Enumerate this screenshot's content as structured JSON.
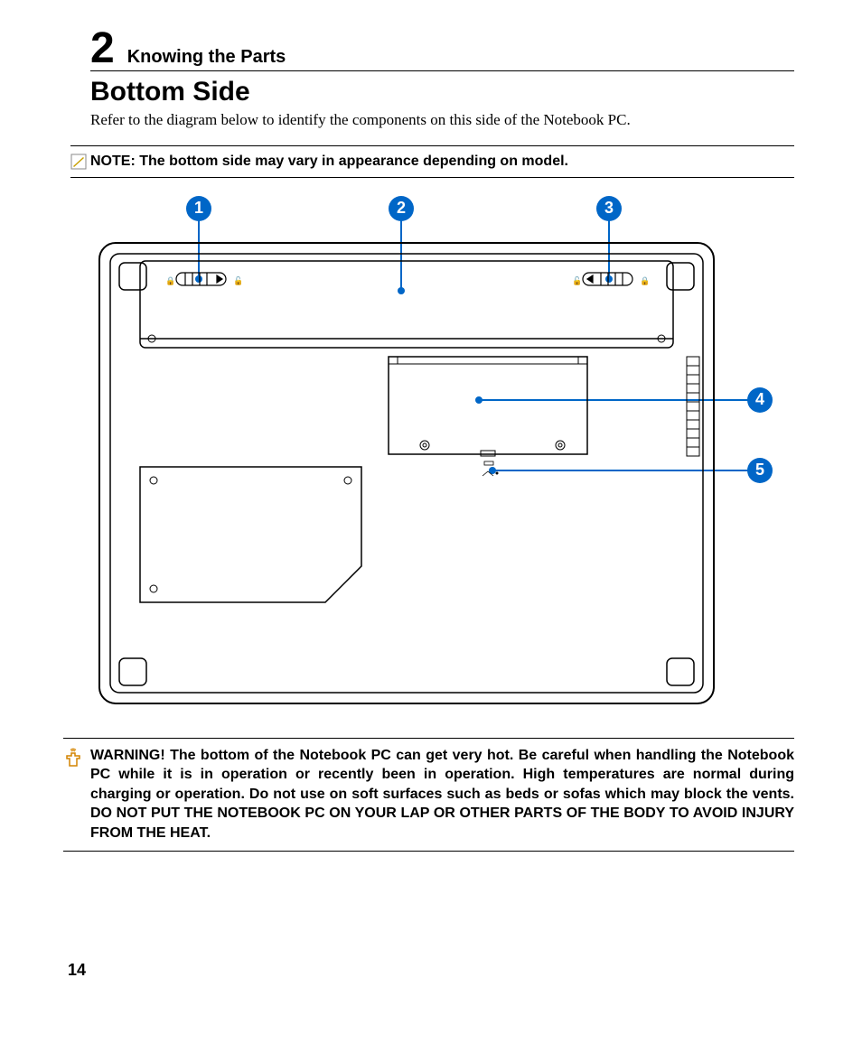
{
  "chapter": {
    "number": "2",
    "title": "Knowing the Parts"
  },
  "section": {
    "title": "Bottom Side",
    "intro": "Refer to the diagram below to identify the components on this side of the Notebook PC."
  },
  "note": {
    "text": "NOTE: The bottom side may vary in appearance depending on model."
  },
  "callouts": {
    "c1": "1",
    "c2": "2",
    "c3": "3",
    "c4": "4",
    "c5": "5"
  },
  "warning": {
    "text": "WARNING!  The bottom of the Notebook PC can get very hot. Be careful when handling the Notebook PC while it is in operation or recently been in operation. High temperatures are normal during charging or operation. Do not use on soft surfaces such as beds or sofas which may block the vents. DO NOT PUT THE NOTEBOOK PC ON YOUR LAP OR OTHER PARTS OF THE BODY TO AVOID INJURY FROM THE HEAT."
  },
  "page_number": "14"
}
